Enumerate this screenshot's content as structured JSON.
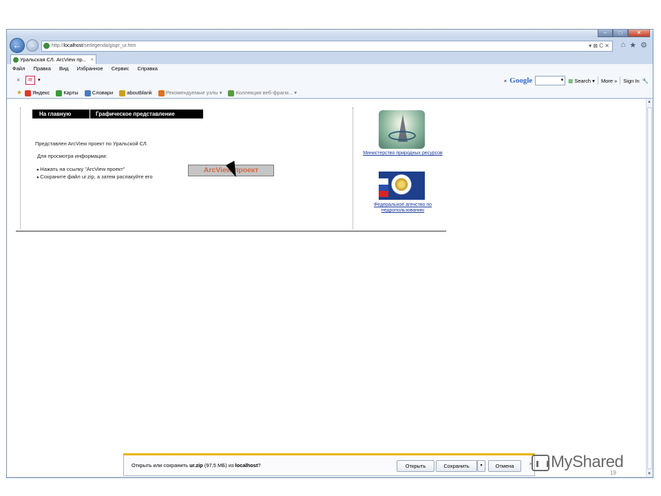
{
  "browser": {
    "address": {
      "prefix": "http://",
      "host": "localhost",
      "path": "/serlegenda/gispr_ur.htm",
      "tools": "▾ ⊠ C ✕"
    },
    "nav_icons": [
      "⌂",
      "★",
      "⚙"
    ],
    "window_buttons": [
      "–",
      "□",
      "✕"
    ],
    "tab": {
      "title": "Уральская СЛ. ArcView пр...",
      "close": "×"
    },
    "menu": [
      "Файл",
      "Правка",
      "Вид",
      "Избранное",
      "Сервис",
      "Справка"
    ],
    "google_bar": {
      "close": "×",
      "google_label": "Google",
      "search_label": "Search",
      "more_label": "More »",
      "signin_label": "Sign In"
    },
    "favorites": [
      {
        "label": "Яндекс",
        "color": "#e03a2a"
      },
      {
        "label": "Карты",
        "color": "#3a9a3a"
      },
      {
        "label": "Словари",
        "color": "#4a7ac0"
      },
      {
        "label": "aboutblank",
        "color": "#c8a020"
      },
      {
        "label": "Рекомендуемые узлы ▾",
        "color": "#e07020",
        "gray": true
      },
      {
        "label": "Коллекция веб-фрагм... ▾",
        "color": "#5a9a40",
        "gray": true
      }
    ]
  },
  "page": {
    "nav": {
      "home": "На главную",
      "graphic": "Графическое представление"
    },
    "intro": "Представлен ArcView проект по Уральской СЛ.",
    "for_info": "Для просмотра информации:",
    "steps": [
      "Нажать на ссылку \"ArcView проект\"",
      "Сохраните файл ur.zip, а затем распакуйте его"
    ],
    "ministry_caption": "Министерство природных ресурсов",
    "agency_caption_1": "Федеральное агенство по",
    "agency_caption_2": "недропользованию",
    "arcview_button": "ArcView проект"
  },
  "download_bar": {
    "text_before": "Открыть или сохранить",
    "filename": "ur.zip",
    "size": "(97,5 МБ)",
    "from": "из",
    "source": "localhost",
    "question": "?",
    "open_label": "Открыть",
    "save_label": "Сохранить",
    "save_dropdown": "▾",
    "cancel_label": "Отмена",
    "close": "×"
  },
  "watermark": {
    "text": "MyShared"
  },
  "slide_number": "19",
  "colors": {
    "chrome": "#c9d8ec",
    "notification_accent": "#e9b400",
    "link": "#1a3a9a",
    "arcview_text": "#d46a4a"
  }
}
